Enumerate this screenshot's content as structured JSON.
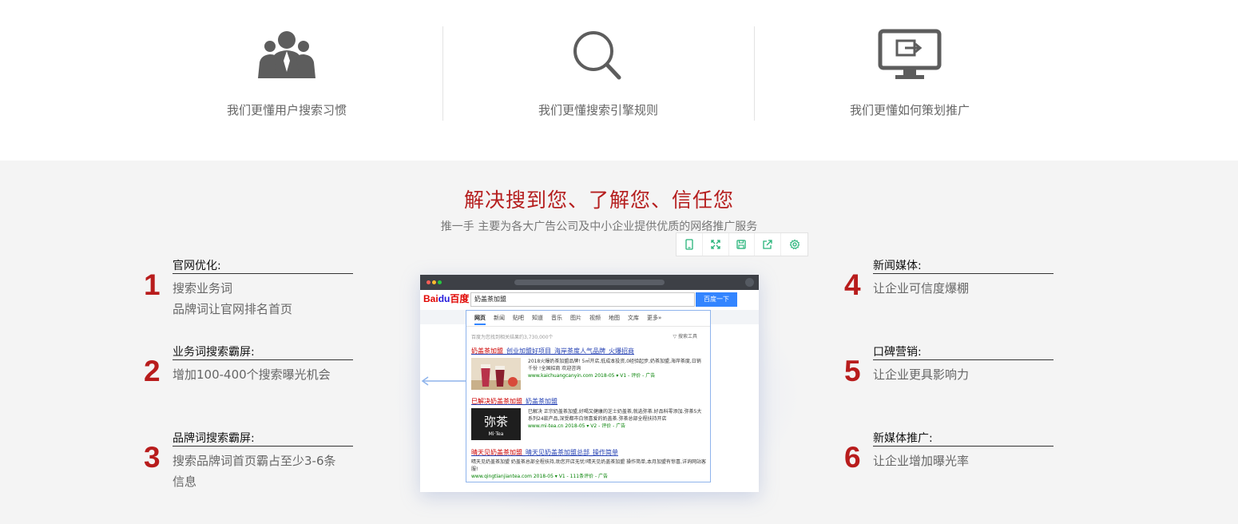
{
  "features": [
    {
      "icon": "users-icon",
      "caption": "我们更懂用户搜索习惯"
    },
    {
      "icon": "search-icon",
      "caption": "我们更懂搜索引擎规则"
    },
    {
      "icon": "monitor-icon",
      "caption": "我们更懂如何策划推广"
    }
  ],
  "section": {
    "title": "解决搜到您、了解您、信任您",
    "subtitle": "推一手 主要为各大广告公司及中小企业提供优质的网络推广服务"
  },
  "items": [
    {
      "num": "1",
      "title": "官网优化:",
      "desc": [
        "搜索业务词",
        "品牌词让官网排名首页"
      ]
    },
    {
      "num": "2",
      "title": "业务词搜索霸屏:",
      "desc": [
        "增加100-400个搜索曝光机会"
      ]
    },
    {
      "num": "3",
      "title": "品牌词搜索霸屏:",
      "desc": [
        "搜索品牌词首页霸占至少3-6条",
        "信息"
      ]
    },
    {
      "num": "4",
      "title": "新闻媒体:",
      "desc": [
        "让企业可信度爆棚"
      ]
    },
    {
      "num": "5",
      "title": "口碑营销:",
      "desc": [
        "让企业更具影响力"
      ]
    },
    {
      "num": "6",
      "title": "新媒体推广:",
      "desc": [
        "让企业增加曝光率"
      ]
    }
  ],
  "toolbar": [
    "mobile-icon",
    "fullscreen-icon",
    "save-icon",
    "share-icon",
    "settings-icon"
  ],
  "colors": {
    "accent": "#b51e1e",
    "number": "#b81c1c",
    "toolbar_icon": "#27b47a",
    "baidu_blue": "#3385ff"
  },
  "screenshot": {
    "logo_text": "Bai",
    "logo_paw": "du",
    "logo_cn": "百度",
    "query": "奶盖茶加盟",
    "button": "百度一下",
    "tabs": [
      "网页",
      "新闻",
      "贴吧",
      "知道",
      "音乐",
      "图片",
      "视频",
      "地图",
      "文库",
      "更多»"
    ],
    "result_info": "百度为您找到相关结果约3,730,000个",
    "search_tools": "搜索工具",
    "r1_title_a": "奶盖茶加盟",
    "r1_title_b": "_创业加盟好项目_海岸茶度人气品牌_火爆招商",
    "r1_text": "2018火爆奶茶加盟品牌! 5㎡开店,低成本投资,0经验起步,奶茶加盟,海岸茶度,日销千份 !全国招商 欢迎咨询",
    "r1_site": "www.kaichuangcanyin.com  2018-05  ▾  V1 - 评价 - 广告",
    "r2_title_a": "巳解决奶盖茶加盟",
    "r2_title_b": "_奶盖茶加盟",
    "r2_text": "巳解决 正宗奶盖茶加盟,好喝又健康的芝士奶盖茶,就选弥茶.好品科零添加.弥茶5大系列24款产品,深受都市白领喜爱的奶盖茶.弥茶总部全程扶持开店",
    "r2_thumb_top": "弥茶",
    "r2_thumb_bottom": "Mi·Tea",
    "r2_site": "www.mi-tea.cn  2018-05  ▾  V2 - 评价 - 广告",
    "r3_title_a": "晴天见奶盖茶加盟",
    "r3_title_b": "_晴天见奶盖茶加盟总部_操作简单",
    "r3_text": "晴天见奶盖茶加盟 奶盖茶总部全程扶持,助您开店无忧!晴天见奶盖茶加盟 操作简单,本月加盟有惊喜,详询网站客服!",
    "r3_site": "www.qingtianjiantea.com  2018-05  ▾  V1 - 111条评价 - 广告"
  }
}
